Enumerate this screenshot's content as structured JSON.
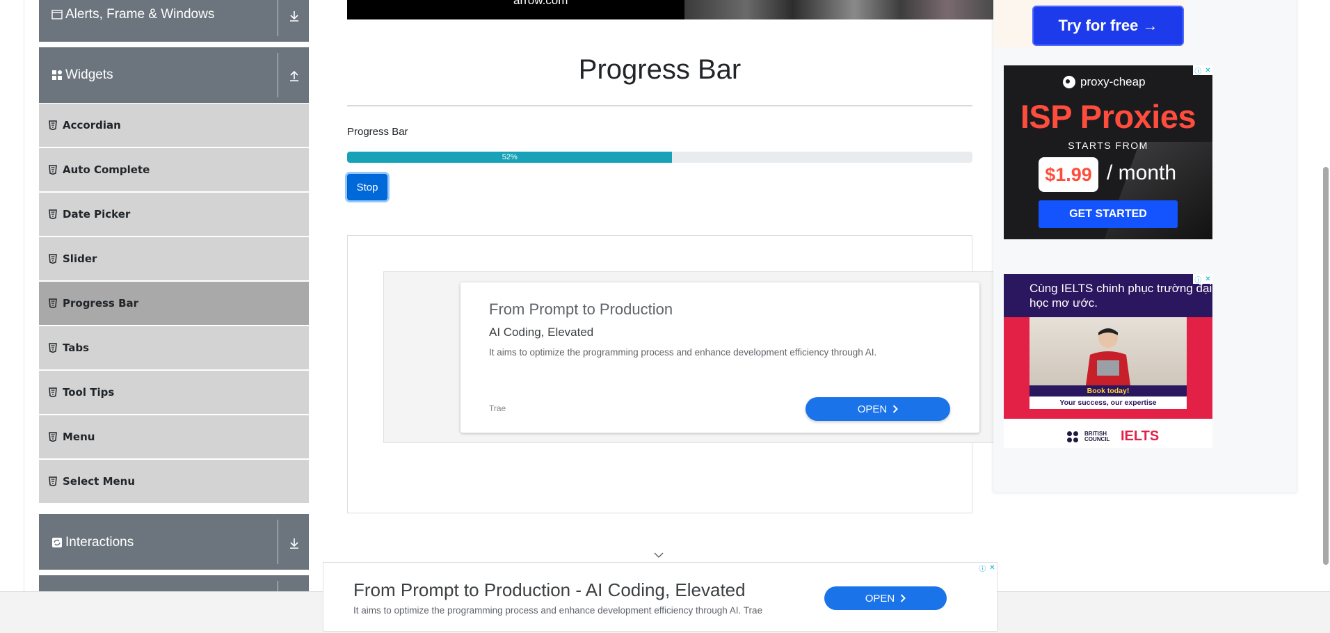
{
  "sidebar": {
    "groups": {
      "alerts": {
        "title": "Alerts, Frame & Windows"
      },
      "widgets": {
        "title": "Widgets"
      },
      "interactions": {
        "title": "Interactions"
      }
    },
    "items": [
      {
        "label": "Accordian"
      },
      {
        "label": "Auto Complete"
      },
      {
        "label": "Date Picker"
      },
      {
        "label": "Slider"
      },
      {
        "label": "Progress Bar",
        "active": true
      },
      {
        "label": "Tabs"
      },
      {
        "label": "Tool Tips"
      },
      {
        "label": "Menu"
      },
      {
        "label": "Select Menu"
      }
    ]
  },
  "top_banner": {
    "text": "arrow.com"
  },
  "main": {
    "title": "Progress Bar",
    "progress_label": "Progress Bar",
    "progress": {
      "value": 52,
      "text": "52%",
      "bar_color": "#17a2b8"
    },
    "stop_button": "Stop"
  },
  "inline_ad": {
    "title": "From Prompt to Production",
    "subtitle": "AI Coding, Elevated",
    "description": "It aims to optimize the programming process and enhance development efficiency through AI.",
    "brand": "Trae",
    "open_label": "OPEN"
  },
  "right_ads": {
    "try_button": "Try for free →",
    "proxy": {
      "brand": "proxy-cheap",
      "headline": "ISP Proxies",
      "starts": "STARTS FROM",
      "price": "$1.99",
      "per": "/ month",
      "cta": "GET STARTED"
    },
    "ielts": {
      "text": "Cùng IELTS chinh phục trường đại học mơ ước.",
      "book": "Book today!",
      "tagline": "Your success, our expertise",
      "bc": "BRITISH COUNCIL",
      "logo": "IELTS"
    }
  },
  "bottom_ad": {
    "title": "From Prompt to Production - AI Coding, Elevated",
    "description": "It aims to optimize the programming process and enhance development efficiency through AI. Trae",
    "open_label": "OPEN"
  },
  "colors": {
    "sidebar_header": "#6c757d",
    "menu_item": "#d3d3d3",
    "menu_active": "#a9a9a9",
    "primary": "#0069d9"
  }
}
